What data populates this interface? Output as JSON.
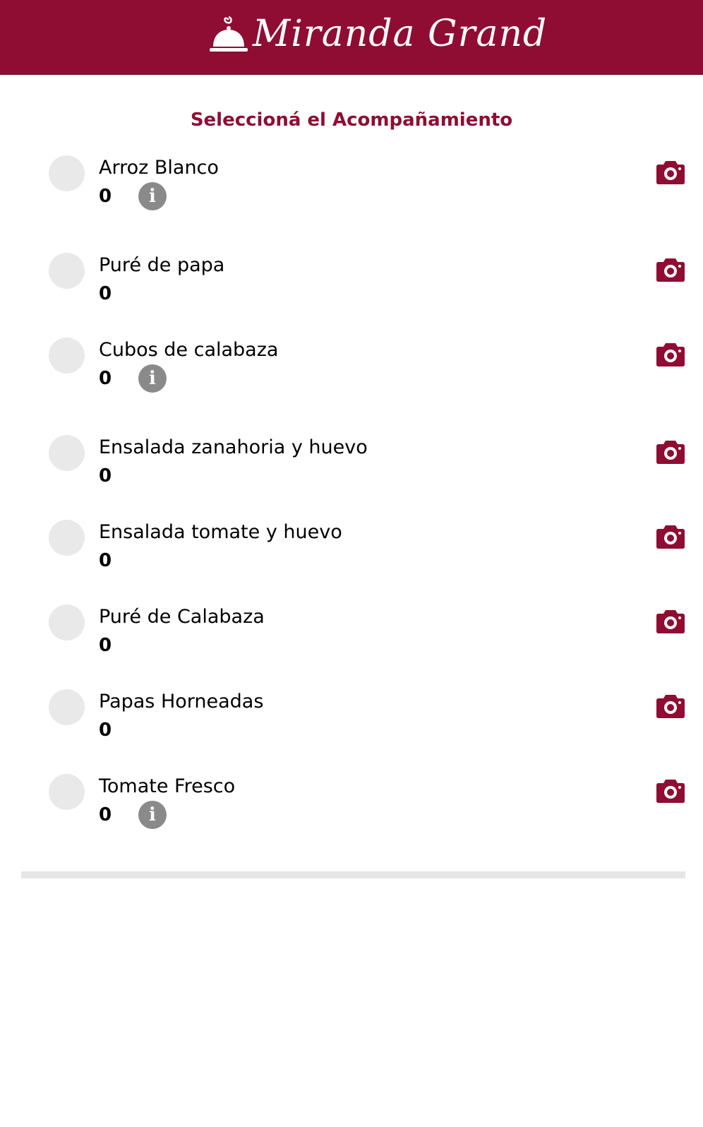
{
  "header": {
    "brand": "Miranda Grand",
    "logo_icon": "cloche-icon",
    "background_color": "#8f0d32"
  },
  "title": "Seleccioná el Acompañamiento",
  "accent_color": "#8f0d32",
  "items": [
    {
      "name": "Arroz Blanco",
      "count": "0",
      "info": true
    },
    {
      "name": "Puré de papa",
      "count": "0",
      "info": false
    },
    {
      "name": "Cubos de calabaza",
      "count": "0",
      "info": true
    },
    {
      "name": "Ensalada zanahoria y huevo",
      "count": "0",
      "info": false
    },
    {
      "name": "Ensalada tomate y huevo",
      "count": "0",
      "info": false
    },
    {
      "name": "Puré de Calabaza",
      "count": "0",
      "info": false
    },
    {
      "name": "Papas Horneadas",
      "count": "0",
      "info": false
    },
    {
      "name": "Tomate Fresco",
      "count": "0",
      "info": true
    }
  ],
  "icons": {
    "info": "i",
    "photo": "camera-icon",
    "selector": "radio-icon"
  }
}
